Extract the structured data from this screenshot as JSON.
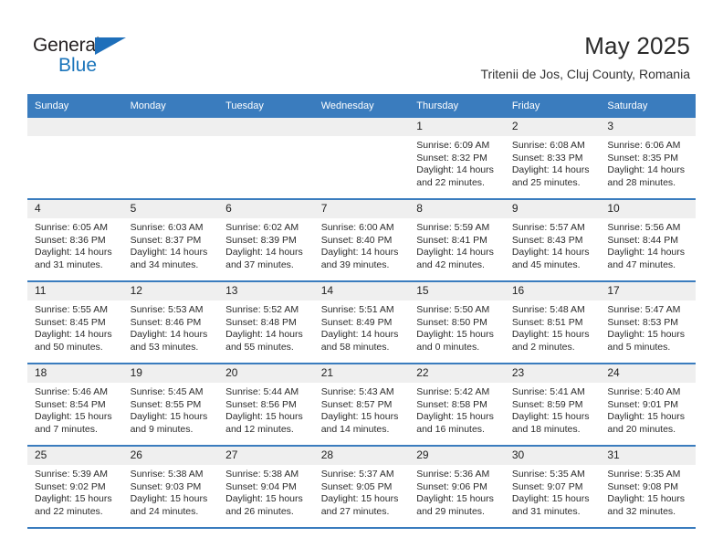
{
  "brand": {
    "name_part1": "General",
    "name_part2": "Blue",
    "triangle_icon": "triangle-icon",
    "accent_color": "#1b75bb"
  },
  "header": {
    "title": "May 2025",
    "subtitle": "Tritenii de Jos, Cluj County, Romania"
  },
  "calendar": {
    "header_bg": "#3a7cbe",
    "daynum_bg": "#efefef",
    "weekday_headers": [
      "Sunday",
      "Monday",
      "Tuesday",
      "Wednesday",
      "Thursday",
      "Friday",
      "Saturday"
    ],
    "weeks": [
      [
        {
          "day": "",
          "sunrise": "",
          "sunset": "",
          "daylight_line1": "",
          "daylight_line2": ""
        },
        {
          "day": "",
          "sunrise": "",
          "sunset": "",
          "daylight_line1": "",
          "daylight_line2": ""
        },
        {
          "day": "",
          "sunrise": "",
          "sunset": "",
          "daylight_line1": "",
          "daylight_line2": ""
        },
        {
          "day": "",
          "sunrise": "",
          "sunset": "",
          "daylight_line1": "",
          "daylight_line2": ""
        },
        {
          "day": "1",
          "sunrise": "Sunrise: 6:09 AM",
          "sunset": "Sunset: 8:32 PM",
          "daylight_line1": "Daylight: 14 hours",
          "daylight_line2": "and 22 minutes."
        },
        {
          "day": "2",
          "sunrise": "Sunrise: 6:08 AM",
          "sunset": "Sunset: 8:33 PM",
          "daylight_line1": "Daylight: 14 hours",
          "daylight_line2": "and 25 minutes."
        },
        {
          "day": "3",
          "sunrise": "Sunrise: 6:06 AM",
          "sunset": "Sunset: 8:35 PM",
          "daylight_line1": "Daylight: 14 hours",
          "daylight_line2": "and 28 minutes."
        }
      ],
      [
        {
          "day": "4",
          "sunrise": "Sunrise: 6:05 AM",
          "sunset": "Sunset: 8:36 PM",
          "daylight_line1": "Daylight: 14 hours",
          "daylight_line2": "and 31 minutes."
        },
        {
          "day": "5",
          "sunrise": "Sunrise: 6:03 AM",
          "sunset": "Sunset: 8:37 PM",
          "daylight_line1": "Daylight: 14 hours",
          "daylight_line2": "and 34 minutes."
        },
        {
          "day": "6",
          "sunrise": "Sunrise: 6:02 AM",
          "sunset": "Sunset: 8:39 PM",
          "daylight_line1": "Daylight: 14 hours",
          "daylight_line2": "and 37 minutes."
        },
        {
          "day": "7",
          "sunrise": "Sunrise: 6:00 AM",
          "sunset": "Sunset: 8:40 PM",
          "daylight_line1": "Daylight: 14 hours",
          "daylight_line2": "and 39 minutes."
        },
        {
          "day": "8",
          "sunrise": "Sunrise: 5:59 AM",
          "sunset": "Sunset: 8:41 PM",
          "daylight_line1": "Daylight: 14 hours",
          "daylight_line2": "and 42 minutes."
        },
        {
          "day": "9",
          "sunrise": "Sunrise: 5:57 AM",
          "sunset": "Sunset: 8:43 PM",
          "daylight_line1": "Daylight: 14 hours",
          "daylight_line2": "and 45 minutes."
        },
        {
          "day": "10",
          "sunrise": "Sunrise: 5:56 AM",
          "sunset": "Sunset: 8:44 PM",
          "daylight_line1": "Daylight: 14 hours",
          "daylight_line2": "and 47 minutes."
        }
      ],
      [
        {
          "day": "11",
          "sunrise": "Sunrise: 5:55 AM",
          "sunset": "Sunset: 8:45 PM",
          "daylight_line1": "Daylight: 14 hours",
          "daylight_line2": "and 50 minutes."
        },
        {
          "day": "12",
          "sunrise": "Sunrise: 5:53 AM",
          "sunset": "Sunset: 8:46 PM",
          "daylight_line1": "Daylight: 14 hours",
          "daylight_line2": "and 53 minutes."
        },
        {
          "day": "13",
          "sunrise": "Sunrise: 5:52 AM",
          "sunset": "Sunset: 8:48 PM",
          "daylight_line1": "Daylight: 14 hours",
          "daylight_line2": "and 55 minutes."
        },
        {
          "day": "14",
          "sunrise": "Sunrise: 5:51 AM",
          "sunset": "Sunset: 8:49 PM",
          "daylight_line1": "Daylight: 14 hours",
          "daylight_line2": "and 58 minutes."
        },
        {
          "day": "15",
          "sunrise": "Sunrise: 5:50 AM",
          "sunset": "Sunset: 8:50 PM",
          "daylight_line1": "Daylight: 15 hours",
          "daylight_line2": "and 0 minutes."
        },
        {
          "day": "16",
          "sunrise": "Sunrise: 5:48 AM",
          "sunset": "Sunset: 8:51 PM",
          "daylight_line1": "Daylight: 15 hours",
          "daylight_line2": "and 2 minutes."
        },
        {
          "day": "17",
          "sunrise": "Sunrise: 5:47 AM",
          "sunset": "Sunset: 8:53 PM",
          "daylight_line1": "Daylight: 15 hours",
          "daylight_line2": "and 5 minutes."
        }
      ],
      [
        {
          "day": "18",
          "sunrise": "Sunrise: 5:46 AM",
          "sunset": "Sunset: 8:54 PM",
          "daylight_line1": "Daylight: 15 hours",
          "daylight_line2": "and 7 minutes."
        },
        {
          "day": "19",
          "sunrise": "Sunrise: 5:45 AM",
          "sunset": "Sunset: 8:55 PM",
          "daylight_line1": "Daylight: 15 hours",
          "daylight_line2": "and 9 minutes."
        },
        {
          "day": "20",
          "sunrise": "Sunrise: 5:44 AM",
          "sunset": "Sunset: 8:56 PM",
          "daylight_line1": "Daylight: 15 hours",
          "daylight_line2": "and 12 minutes."
        },
        {
          "day": "21",
          "sunrise": "Sunrise: 5:43 AM",
          "sunset": "Sunset: 8:57 PM",
          "daylight_line1": "Daylight: 15 hours",
          "daylight_line2": "and 14 minutes."
        },
        {
          "day": "22",
          "sunrise": "Sunrise: 5:42 AM",
          "sunset": "Sunset: 8:58 PM",
          "daylight_line1": "Daylight: 15 hours",
          "daylight_line2": "and 16 minutes."
        },
        {
          "day": "23",
          "sunrise": "Sunrise: 5:41 AM",
          "sunset": "Sunset: 8:59 PM",
          "daylight_line1": "Daylight: 15 hours",
          "daylight_line2": "and 18 minutes."
        },
        {
          "day": "24",
          "sunrise": "Sunrise: 5:40 AM",
          "sunset": "Sunset: 9:01 PM",
          "daylight_line1": "Daylight: 15 hours",
          "daylight_line2": "and 20 minutes."
        }
      ],
      [
        {
          "day": "25",
          "sunrise": "Sunrise: 5:39 AM",
          "sunset": "Sunset: 9:02 PM",
          "daylight_line1": "Daylight: 15 hours",
          "daylight_line2": "and 22 minutes."
        },
        {
          "day": "26",
          "sunrise": "Sunrise: 5:38 AM",
          "sunset": "Sunset: 9:03 PM",
          "daylight_line1": "Daylight: 15 hours",
          "daylight_line2": "and 24 minutes."
        },
        {
          "day": "27",
          "sunrise": "Sunrise: 5:38 AM",
          "sunset": "Sunset: 9:04 PM",
          "daylight_line1": "Daylight: 15 hours",
          "daylight_line2": "and 26 minutes."
        },
        {
          "day": "28",
          "sunrise": "Sunrise: 5:37 AM",
          "sunset": "Sunset: 9:05 PM",
          "daylight_line1": "Daylight: 15 hours",
          "daylight_line2": "and 27 minutes."
        },
        {
          "day": "29",
          "sunrise": "Sunrise: 5:36 AM",
          "sunset": "Sunset: 9:06 PM",
          "daylight_line1": "Daylight: 15 hours",
          "daylight_line2": "and 29 minutes."
        },
        {
          "day": "30",
          "sunrise": "Sunrise: 5:35 AM",
          "sunset": "Sunset: 9:07 PM",
          "daylight_line1": "Daylight: 15 hours",
          "daylight_line2": "and 31 minutes."
        },
        {
          "day": "31",
          "sunrise": "Sunrise: 5:35 AM",
          "sunset": "Sunset: 9:08 PM",
          "daylight_line1": "Daylight: 15 hours",
          "daylight_line2": "and 32 minutes."
        }
      ]
    ]
  }
}
